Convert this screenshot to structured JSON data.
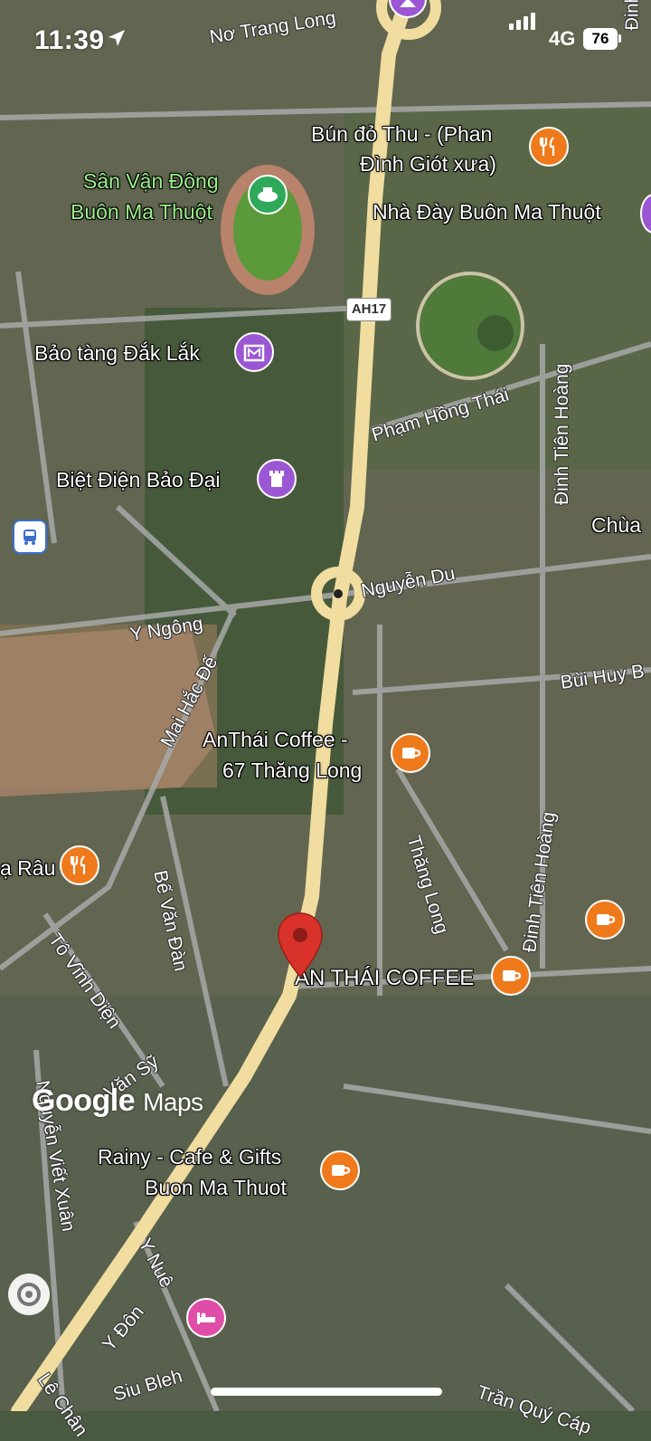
{
  "status_bar": {
    "time": "11:39",
    "network": "4G",
    "battery": "76"
  },
  "colors": {
    "poi_orange": "#ee7a1c",
    "poi_purple": "#9b57d3",
    "poi_green": "#2ea95a",
    "poi_pink": "#e04da8",
    "pin_red": "#d8322b"
  },
  "route_shield": "AH17",
  "places": {
    "bun_do_thu_line1": "Bún đỏ Thu - (Phan",
    "bun_do_thu_line2": "Đình Giót xưa)",
    "stadium_line1": "Sân Vận Động",
    "stadium_line2": "Buôn Ma Thuột",
    "nha_day": "Nhà Đày Buôn Ma Thuột",
    "bao_tang": "Bảo tàng Đắk Lắk",
    "biet_dien": "Biệt Điện Bảo Đại",
    "chua": "Chùa",
    "anthai_line1": "AnThái Coffee -",
    "anthai_line2": "67 Thăng Long",
    "rau": "ạ Râu",
    "an_thai_coffee": "AN THÁI COFFEE",
    "rainy_line1": "Rainy - Cafe & Gifts",
    "rainy_line2": "Buon Ma Thuot"
  },
  "roads": {
    "no_trang_long": "Nơ Trang Long",
    "pham_hong_thai": "Phạm Hồng Thái",
    "dinh_tien_hoang_1": "Đinh Tiên Hoàng",
    "dinh_tien_hoang_2": "Đinh Tiên Hoàng",
    "dinh": "Đinh",
    "nguyen_du": "Nguyễn Du",
    "y_ngong": "Y Ngông",
    "mai_hac_de": "Mai Hắc Đế",
    "bui_huy": "Bùi Huy B",
    "thang_long": "Thăng Long",
    "be_van_dan": "Bế Văn Đàn",
    "to_vinh_dien": "Tô Vĩnh Diện",
    "van_sy": "Văn Sỹ",
    "nguyen_viet_xuan": "Nguyễn Viết Xuân",
    "y_nue": "Y Nuê",
    "y_don": "Y Đôn",
    "siu_bleh": "Siu Bleh",
    "le_chan": "Lê Chân",
    "tran_quy_cap": "Trần Quý Cáp"
  },
  "branding": {
    "google": "Google",
    "maps": "Maps"
  }
}
